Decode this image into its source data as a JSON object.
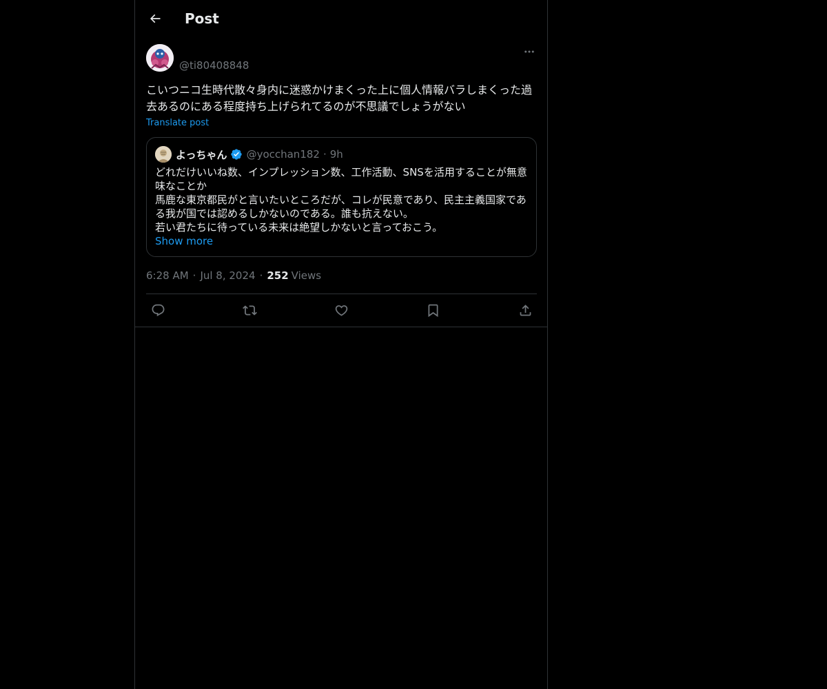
{
  "header": {
    "title": "Post",
    "back_icon": "arrow-left-icon"
  },
  "post": {
    "handle": "@ti80408848",
    "avatar_icon": "avatar-image",
    "text": "こいつニコ生時代散々身内に迷惑かけまくった上に個人情報バラしまくった過去あるのにある程度持ち上げられてるのが不思議でしょうがない",
    "translate_label": "Translate post",
    "time": "6:28 AM",
    "date": "Jul 8, 2024",
    "views_count": "252",
    "views_label": "Views"
  },
  "quote": {
    "name": "よっちゃん",
    "handle": "@yocchan182",
    "separator": "·",
    "time": "9h",
    "verified_color": "#1d9bf0",
    "lines": [
      "どれだけいいね数、インプレッション数、工作活動、SNSを活用することが無意味なことか",
      "馬鹿な東京都民がと言いたいところだが、コレが民意であり、民主主義国家である我が国では認めるしかないのである。誰も抗えない。",
      "若い君たちに待っている未来は絶望しかないと言っておこう。"
    ],
    "show_more_label": "Show more"
  },
  "meta": {
    "separator": "·"
  },
  "actions": {
    "reply_icon": "reply-icon",
    "repost_icon": "repost-icon",
    "like_icon": "heart-icon",
    "bookmark_icon": "bookmark-icon",
    "share_icon": "share-icon"
  },
  "colors": {
    "background": "#000000",
    "text": "#e7e9ea",
    "muted": "#71767b",
    "accent": "#1d9bf0",
    "border": "#2f3336"
  }
}
